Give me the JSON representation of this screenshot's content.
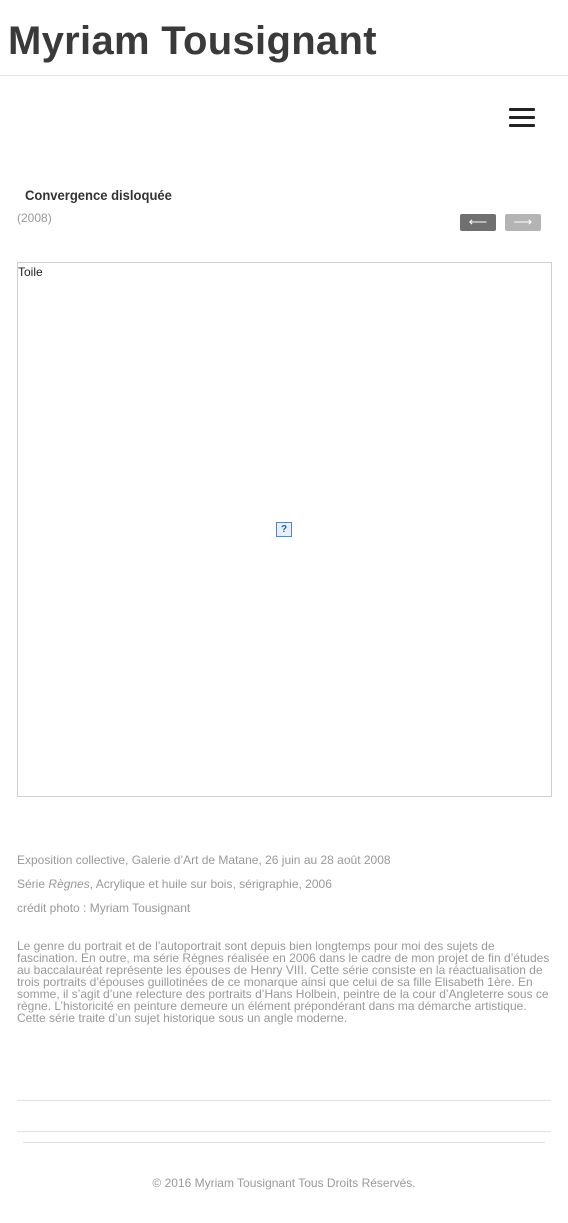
{
  "header": {
    "site_title": "Myriam Tousignant"
  },
  "menu": {
    "icon": "hamburger-menu-icon"
  },
  "work": {
    "title": "Convergence disloquée",
    "year": "(2008)",
    "prev_arrow": "⟵",
    "next_arrow": "⟶",
    "image_alt": "Toile",
    "broken_image_glyph": "?"
  },
  "details": {
    "exhibition": "Exposition collective, Galerie d’Art de Matane, 26 juin au 28 août 2008",
    "series_prefix": "Série ",
    "series_name": "Règnes",
    "series_suffix": ", Acrylique et huile sur bois, sérigraphie, 2006",
    "photo_credit": "crédit photo : Myriam Tousignant"
  },
  "description": "Le genre du portrait et de l’autoportrait sont depuis bien longtemps pour moi des sujets de fascination. En outre, ma série Règnes réalisée en 2006 dans le cadre de mon projet de fin d’études au baccalauréat représente les épouses de Henry VIII. Cette série consiste en la réactualisation de trois portraits d’épouses guillotinées de ce monarque ainsi que celui de sa fille Elisabeth 1ère. En somme, il s’agit d’une relecture des portraits d’Hans Holbein, peintre de la cour d’Angleterre sous ce règne. L’historicité en peinture demeure un élément prépondérant dans ma démarche artistique. Cette série traite d’un sujet historique sous un angle moderne.",
  "footer": {
    "copyright": "© 2016 Myriam Tousignant Tous Droits Réservés."
  },
  "colors": {
    "title_text": "#3a3a3a",
    "muted_text": "#999999",
    "prev_button": "#707070",
    "next_button": "#b4b4b4",
    "rule": "#e0e0e0"
  }
}
